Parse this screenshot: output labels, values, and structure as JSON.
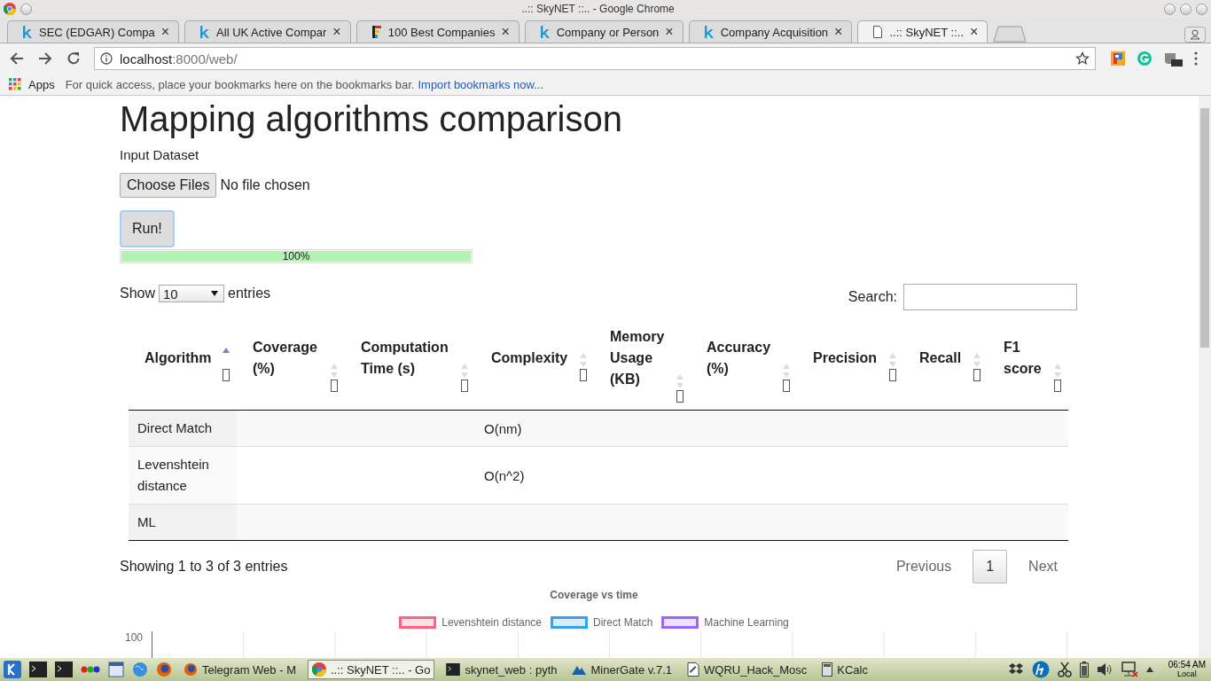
{
  "window": {
    "title": "..:: SkyNET ::.. - Google Chrome"
  },
  "tabs": [
    {
      "label": "SEC (EDGAR) Compa",
      "kind": "k",
      "close": "×",
      "selected": false
    },
    {
      "label": "All UK Active Compar",
      "kind": "k",
      "close": "×",
      "selected": false
    },
    {
      "label": "100 Best Companies",
      "kind": "f",
      "close": "×",
      "selected": false
    },
    {
      "label": "Company or Person",
      "kind": "k",
      "close": "×",
      "selected": false
    },
    {
      "label": "Company Acquisition",
      "kind": "k",
      "close": "×",
      "selected": false
    },
    {
      "label": "..:: SkyNET ::..",
      "kind": "page",
      "close": "×",
      "selected": true
    }
  ],
  "address": {
    "host": "localhost",
    "rest": ":8000/web/"
  },
  "bookmarks_bar": {
    "apps": "Apps",
    "hint": "For quick access, place your bookmarks here on the bookmarks bar.",
    "link": "Import bookmarks now..."
  },
  "page": {
    "heading": "Mapping algorithms comparison",
    "input_label": "Input Dataset",
    "file_button": "Choose Files",
    "file_status": "No file chosen",
    "run_button": "Run!",
    "progress": {
      "level": 1,
      "label": "100%"
    },
    "length": {
      "show": "Show",
      "value": "10",
      "entries": "entries"
    },
    "search": {
      "label": "Search:"
    },
    "table": {
      "columns": [
        {
          "label": "Algorithm",
          "sorted": true
        },
        {
          "label": "Coverage (%)",
          "sorted": false
        },
        {
          "label": "Computation Time (s)",
          "sorted": false
        },
        {
          "label": "Complexity",
          "sorted": false
        },
        {
          "label": "Memory Usage (KB)",
          "sorted": false
        },
        {
          "label": "Accuracy (%)",
          "sorted": false
        },
        {
          "label": "Precision",
          "sorted": false
        },
        {
          "label": "Recall",
          "sorted": false
        },
        {
          "label": "F1 score",
          "sorted": false
        }
      ],
      "rows": [
        {
          "algorithm": "Direct Match",
          "complexity": "O(nm)"
        },
        {
          "algorithm": "Levenshtein distance",
          "complexity": "O(n^2)"
        },
        {
          "algorithm": "ML"
        }
      ]
    },
    "info": "Showing 1 to 3 of 3 entries",
    "pagination": {
      "previous": "Previous",
      "page": "1",
      "next": "Next"
    },
    "chart": {
      "title": "Coverage vs time",
      "legend": [
        {
          "name": "Levenshtein distance",
          "color": "#ff6384"
        },
        {
          "name": "Direct Match",
          "color": "#36a2eb"
        },
        {
          "name": "Machine Learning",
          "color": "#9966ff"
        }
      ],
      "y_tick": "100"
    }
  },
  "taskbar": {
    "items": [
      {
        "label": "Telegram Web - M",
        "kind": "firefox",
        "selected": false
      },
      {
        "label": "..:: SkyNET ::.. - Go",
        "kind": "chrome",
        "selected": true
      },
      {
        "label": "skynet_web : pyth",
        "kind": "terminal",
        "selected": false
      },
      {
        "label": "MinerGate v.7.1",
        "kind": "miner",
        "selected": false
      },
      {
        "label": "WQRU_Hack_Mosc",
        "kind": "editor",
        "selected": false
      },
      {
        "label": "KCalc",
        "kind": "calc",
        "selected": false
      }
    ],
    "time": "06:54 AM",
    "zone": "Local"
  }
}
